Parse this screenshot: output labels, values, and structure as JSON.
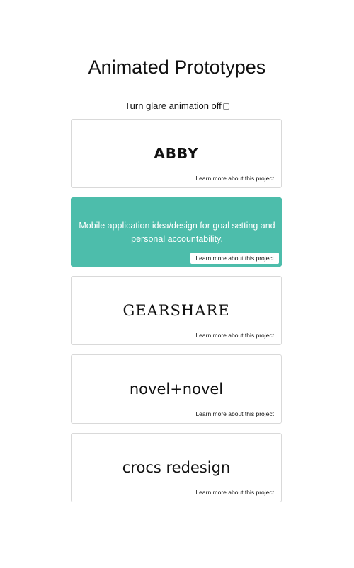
{
  "page": {
    "title": "Animated Prototypes",
    "glare_toggle_label": "Turn glare animation off",
    "glare_toggle_checked": false
  },
  "cards": [
    {
      "title": "ABBY",
      "description": "Mobile application idea/design for goal setting and personal accountability.",
      "link_label": "Learn more about this project"
    },
    {
      "title": "ABBY",
      "description": "Mobile application idea/design for goal setting and personal accountability.",
      "link_label": "Learn more about this project"
    },
    {
      "title": "GEARSHARE",
      "link_label": "Learn more about this project"
    },
    {
      "title": "novel+novel",
      "link_label": "Learn more about this project"
    },
    {
      "title": "crocs redesign",
      "link_label": "Learn more about this project"
    }
  ],
  "colors": {
    "accent": "#4dbdab",
    "card_border": "#d9d9d9",
    "text": "#111111"
  }
}
